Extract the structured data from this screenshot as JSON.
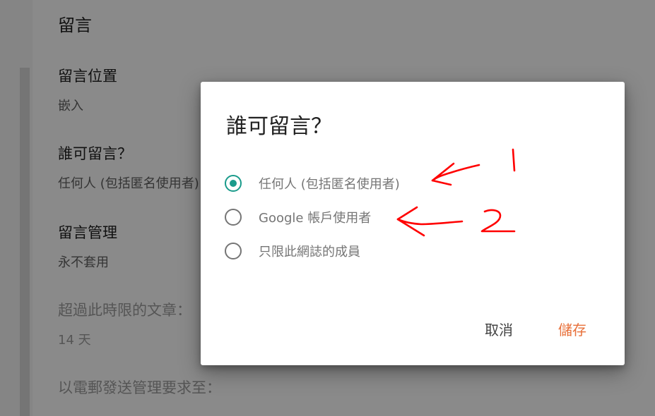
{
  "background_settings": {
    "section_title": "留言",
    "items": [
      {
        "label": "留言位置",
        "value": "嵌入"
      },
      {
        "label": "誰可留言？",
        "value": "任何人 (包括匿名使用者)"
      },
      {
        "label": "留言管理",
        "value": "永不套用"
      },
      {
        "label": "超過此時限的文章：",
        "value": "14 天"
      },
      {
        "label": "以電郵發送管理要求至：",
        "value": ""
      }
    ]
  },
  "dialog": {
    "title": "誰可留言？",
    "options": [
      {
        "label": "任何人 (包括匿名使用者)",
        "checked": true
      },
      {
        "label": "Google 帳戶使用者",
        "checked": false
      },
      {
        "label": "只限此網誌的成員",
        "checked": false
      }
    ],
    "cancel_label": "取消",
    "save_label": "儲存"
  },
  "annotations": {
    "color": "#ff0000",
    "marks": [
      "1",
      "2"
    ]
  },
  "colors": {
    "accent_teal": "#1a9b8b",
    "save_orange": "#e8703a"
  }
}
